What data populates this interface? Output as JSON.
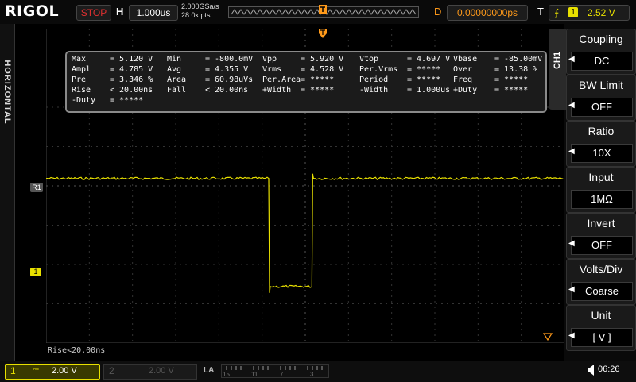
{
  "brand": {
    "name_start": "RIGOL",
    "name_rest": ""
  },
  "top": {
    "run_state": "STOP",
    "h_label": "H",
    "h_value": "1.000us",
    "sample_rate": "2.000GSa/s",
    "memory_depth": "28.0k pts",
    "delay_label": "D",
    "delay_value": "0.00000000ps",
    "trigger_label": "T",
    "trigger_channel": "1",
    "trigger_level": "2.52 V"
  },
  "left_strip_label": "HORIZONTAL",
  "channel_tab": "CH1",
  "menu": [
    {
      "title": "Coupling",
      "value": "DC",
      "arrow": true
    },
    {
      "title": "BW Limit",
      "value": "OFF",
      "arrow": true
    },
    {
      "title": "Ratio",
      "value": "10X",
      "arrow": true
    },
    {
      "title": "Input",
      "value": "1MΩ",
      "arrow": false
    },
    {
      "title": "Invert",
      "value": "OFF",
      "arrow": true
    },
    {
      "title": "Volts/Div",
      "value": "Coarse",
      "arrow": true
    },
    {
      "title": "Unit",
      "value": "[  V  ]",
      "arrow": true
    }
  ],
  "measurements": [
    [
      [
        "Max",
        "= 5.120 V"
      ],
      [
        "Min",
        "= -800.0mV"
      ],
      [
        "Vpp",
        "= 5.920 V"
      ],
      [
        "Vtop",
        "= 4.697 V"
      ],
      [
        "Vbase",
        "= -85.00mV"
      ]
    ],
    [
      [
        "Ampl",
        "= 4.785 V"
      ],
      [
        "Avg",
        "= 4.355 V"
      ],
      [
        "Vrms",
        "= 4.528 V"
      ],
      [
        "Per.Vrms",
        "= *****"
      ],
      [
        "Over",
        "= 13.38 %"
      ]
    ],
    [
      [
        "Pre",
        "= 3.346 %"
      ],
      [
        "Area",
        "= 60.98uVs"
      ],
      [
        "Per.Area",
        "= *****"
      ],
      [
        "Period",
        "= *****"
      ],
      [
        "Freq",
        "= *****"
      ]
    ],
    [
      [
        "Rise",
        "< 20.00ns"
      ],
      [
        "Fall",
        "< 20.00ns"
      ],
      [
        "+Width",
        "= *****"
      ],
      [
        "-Width",
        "= 1.000us"
      ],
      [
        "+Duty",
        "= *****"
      ]
    ],
    [
      [
        "-Duty",
        "= *****"
      ]
    ]
  ],
  "markers": {
    "ref_marker": "R1",
    "ch1_marker": "1"
  },
  "status_line": "Rise<20.00ns",
  "bottom": {
    "ch1_num": "1",
    "ch1_scale": "2.00 V",
    "ch2_num": "2",
    "ch2_scale": "2.00 V",
    "la_label": "LA",
    "la_digits": [
      "15",
      "11",
      "7",
      "3"
    ],
    "clock": "06:26"
  },
  "colors": {
    "ch1": "#e8e000",
    "trigger": "#ff9a1a",
    "stop": "#e03030"
  },
  "waveform": {
    "volts_per_div": 2.0,
    "time_per_div_us": 1.0,
    "high_level_v": 4.7,
    "low_level_v": -0.8,
    "pulse_start_div": 6.0,
    "pulse_end_div": 7.0
  }
}
